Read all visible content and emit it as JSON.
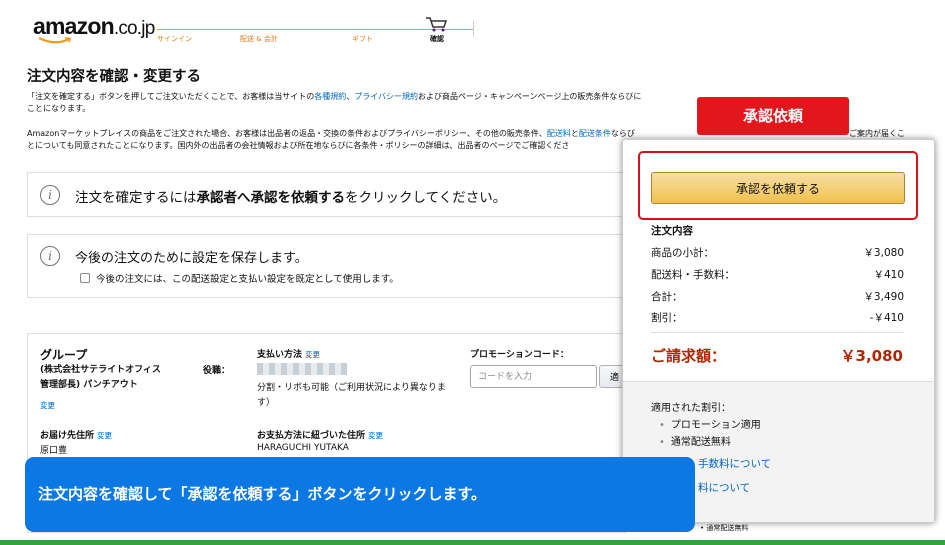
{
  "header": {
    "logo_text": "amazon",
    "logo_tld": ".co.jp",
    "steps": [
      "サインイン",
      "配送 & 会計",
      "ギフト",
      "確認"
    ],
    "cart_icon": "cart-icon"
  },
  "page": {
    "title": "注文内容を確認・変更する",
    "legal_1": {
      "before": "「注文を確定する」ボタンを押してご注文いただくことで、お客様は当サイトの",
      "link_terms": "各種規約",
      "sep": "、",
      "link_privacy": "プライバシー規約",
      "after": "および商品ページ・キャンペーンページ上の販売条件ならびに",
      "line2": "ことになります。"
    },
    "legal_2": {
      "before": "Amazonマーケットプレイスの商品をご注文された場合、お客様は出品者の返品・交換の条件およびプライバシーポリシー、その他の販売条件、",
      "link_fee": "配送料",
      "sep": "と",
      "link_cond": "配送条件",
      "after": "ならび",
      "tail": "ご案内が届くこ",
      "line2": "とについても同意されたことになります。国内外の出品者の会社情報および所在地ならびに各条件・ポリシーの詳細は、出品者のページでご確認くださ"
    }
  },
  "approval_info": {
    "icon": "info-icon",
    "text_pre": "注文を確定するには",
    "text_bold": "承認者へ承認を依頼する",
    "text_post": "をクリックしてください。"
  },
  "save_settings": {
    "icon": "info-icon",
    "text": "今後の注文のために設定を保存します。",
    "checkbox_label": "今後の注文には、この配送設定と支払い設定を既定として使用します。",
    "checked": false
  },
  "details": {
    "group_heading": "グループ",
    "group_line1": "(株式会社サテライトオフィス",
    "group_line2": "管理部長) パンチアウト",
    "group_role": "役職：",
    "group_change": "変更",
    "payment_heading": "支払い方法",
    "payment_change": "変更",
    "payment_note": "分割・リボも可能（ご利用状況により異なります）",
    "promo_heading": "プロモーションコード：",
    "promo_placeholder": "コードを入力",
    "promo_button": "適",
    "shipping_heading": "お届け先住所",
    "shipping_change": "変更",
    "shipping_name": "原口豊",
    "billing_heading": "お支払方法に紐づいた住所",
    "billing_change": "変更",
    "billing_name": "HARAGUCHI YUTAKA"
  },
  "summary": {
    "request_button": "承認を依頼する",
    "order_heading": "注文内容",
    "subtotal_label": "商品の小計：",
    "subtotal_value": "￥3,080",
    "shipping_label": "配送料・手数料：",
    "shipping_value": "￥410",
    "total_label": "合計：",
    "total_value": "￥3,490",
    "discount_label": "割引：",
    "discount_value": "-￥410",
    "grand_label": "ご請求額：",
    "grand_value": "￥3,080",
    "applied_heading": "適用された割引：",
    "applied_items": [
      "プロモーション適用",
      "通常配送無料"
    ],
    "fee_link": "手数料について",
    "other_link": "料について"
  },
  "annotation": {
    "badge": "承認依頼",
    "caption": "注文内容を確認して「承認を依頼する」ボタンをクリックします。",
    "caption_tail": "• 通常配送無料"
  },
  "colors": {
    "accent_orange": "#e47911",
    "link": "#0066c0",
    "price_red": "#b12704",
    "highlight_red": "#e3161b",
    "caption_blue": "#0b78e3",
    "bottom_green": "#2ea540",
    "button_yellow": "#f0c14b"
  }
}
